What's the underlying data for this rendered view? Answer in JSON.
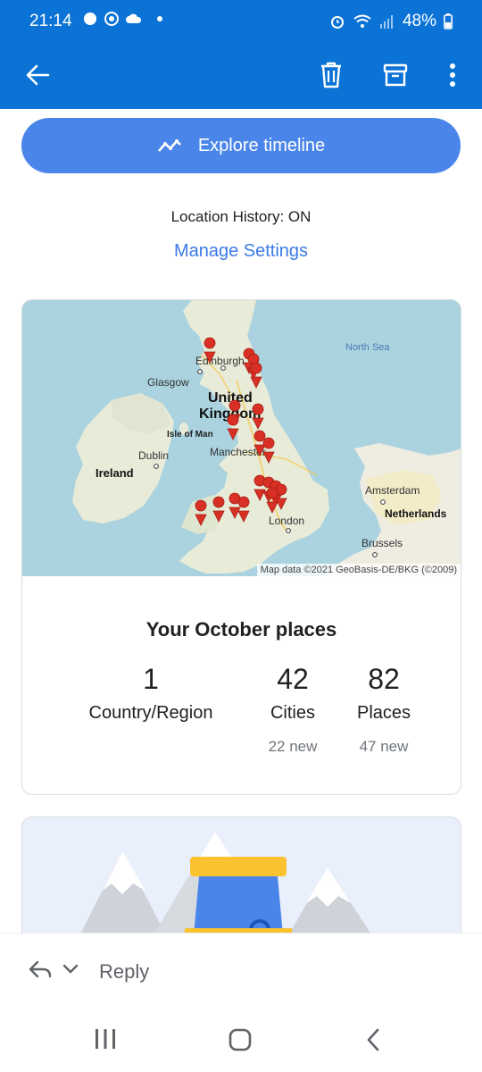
{
  "status_bar": {
    "time": "21:14",
    "battery": "48%"
  },
  "app_bar": {
    "back_icon": "arrow-left-icon",
    "delete_icon": "trash-icon",
    "archive_icon": "archive-icon",
    "more_icon": "more-vert-icon"
  },
  "explore": {
    "label": "Explore timeline",
    "icon": "timeline-icon"
  },
  "location_history": {
    "status_text": "Location History: ON",
    "manage_link": "Manage Settings"
  },
  "map": {
    "labels": {
      "north_sea": "North Sea",
      "edinburgh": "Edinburgh",
      "glasgow": "Glasgow",
      "united_kingdom_1": "United",
      "united_kingdom_2": "Kingdom",
      "isle_of_man": "Isle of Man",
      "manchester": "Manchester",
      "dublin": "Dublin",
      "ireland": "Ireland",
      "amsterdam": "Amsterdam",
      "netherlands": "Netherlands",
      "london": "London",
      "brussels": "Brussels"
    },
    "credit": "Map data ©2021 GeoBasis-DE/BKG (©2009)"
  },
  "october": {
    "title": "Your October places",
    "stats": [
      {
        "value": "1",
        "label": "Country/Region",
        "new": ""
      },
      {
        "value": "42",
        "label": "Cities",
        "new": "22 new"
      },
      {
        "value": "82",
        "label": "Places",
        "new": "47 new"
      }
    ]
  },
  "reply_bar": {
    "reply_label": "Reply"
  },
  "colors": {
    "brand_blue": "#0b73d6",
    "button_blue": "#4a86ea",
    "link_blue": "#3b7be6",
    "pin_red": "#d93025"
  }
}
